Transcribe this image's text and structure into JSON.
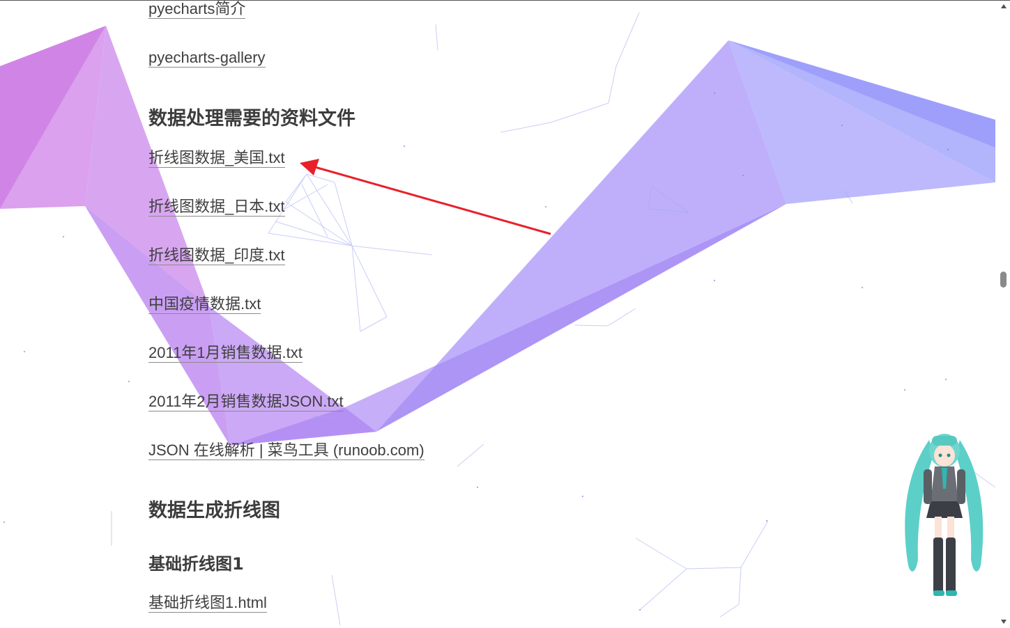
{
  "sections": {
    "links_top": [
      {
        "label": "pyecharts简介"
      },
      {
        "label": "pyecharts-gallery"
      }
    ],
    "heading_files": "数据处理需要的资料文件",
    "file_links": [
      {
        "label": "折线图数据_美国.txt"
      },
      {
        "label": "折线图数据_日本.txt"
      },
      {
        "label": "折线图数据_印度.txt"
      },
      {
        "label": "中国疫情数据.txt"
      },
      {
        "label": "2011年1月销售数据.txt"
      },
      {
        "label": "2011年2月销售数据JSON.txt"
      },
      {
        "label": "JSON 在线解析 | 菜鸟工具 (runoob.com)"
      }
    ],
    "heading_generate": "数据生成折线图",
    "subheading_basic": "基础折线图1",
    "basic_link": "基础折线图1.html"
  },
  "colors": {
    "text": "#3f3f3f",
    "arrow": "#e8202a",
    "ribbon_pink": "#d27ce3",
    "ribbon_purple": "#b9a7fb",
    "ribbon_blue": "#a8a4fb"
  },
  "icons": {
    "annotation_arrow": "red-arrow-icon",
    "mascot": "anime-mascot-icon",
    "scroll_up": "scroll-up-icon",
    "scroll_down": "scroll-down-icon"
  }
}
